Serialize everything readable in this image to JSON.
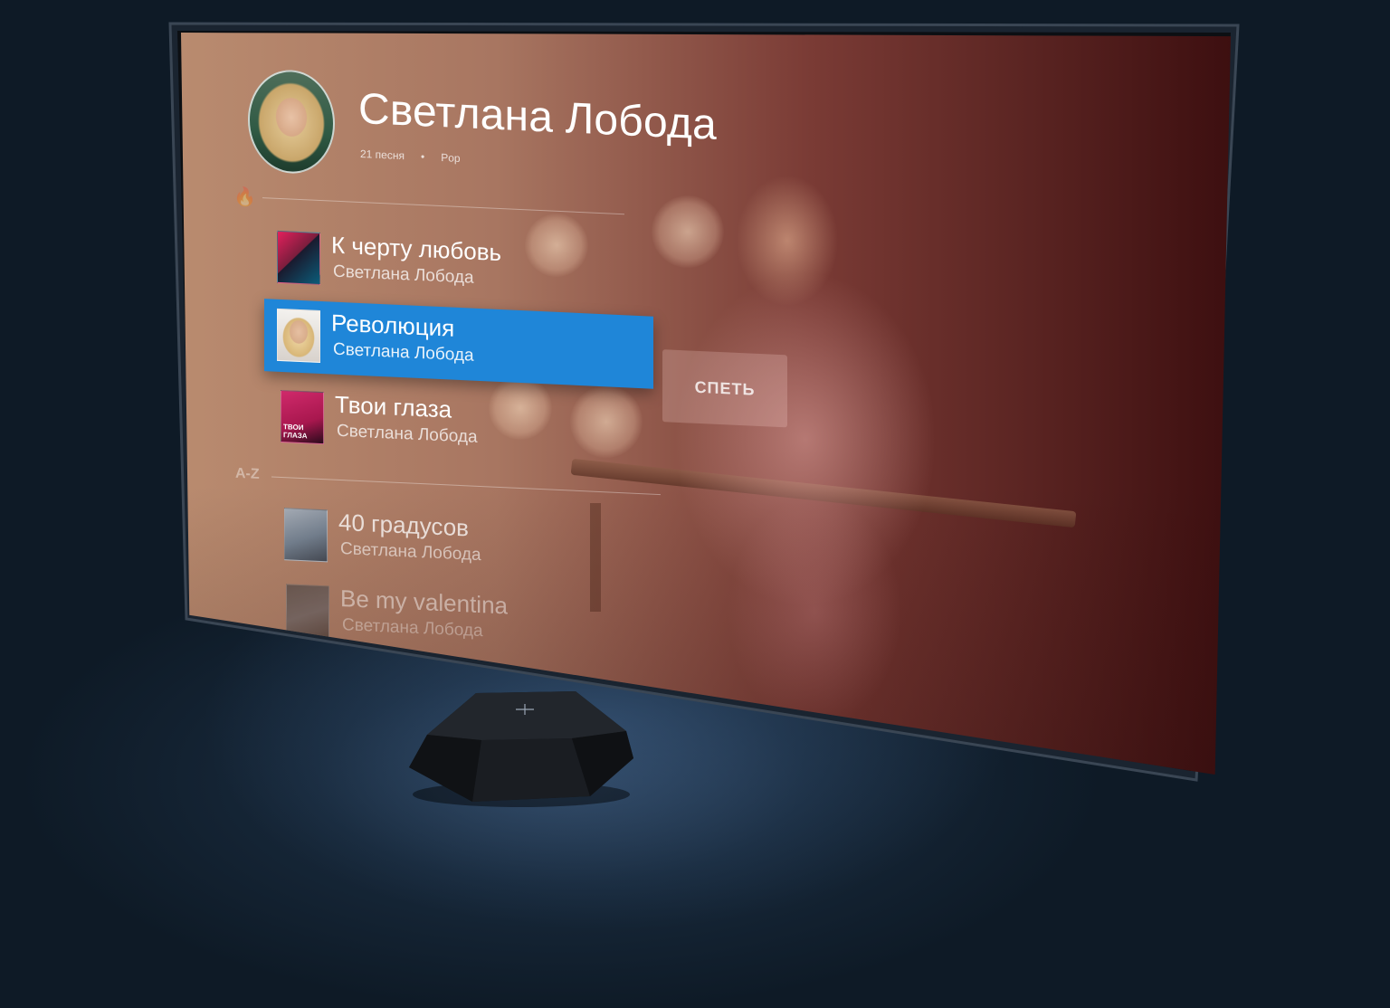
{
  "artist": {
    "name": "Светлана Лобода",
    "song_count": "21 песня",
    "genre": "Pop"
  },
  "sections": {
    "popular_icon": "flame-icon",
    "az_label": "A-Z"
  },
  "songs": [
    {
      "title": "К черту любовь",
      "artist": "Светлана Лобода",
      "selected": false
    },
    {
      "title": "Революция",
      "artist": "Светлана Лобода",
      "selected": true
    },
    {
      "title": "Твои глаза",
      "artist": "Светлана Лобода",
      "selected": false,
      "cover_text": "ТВОИ ГЛАЗА"
    },
    {
      "title": "40 градусов",
      "artist": "Светлана Лобода",
      "selected": false
    },
    {
      "title": "Be my valentina",
      "artist": "Светлана Лобода",
      "selected": false
    }
  ],
  "actions": {
    "sing_label": "СПЕТЬ"
  },
  "colors": {
    "selection": "#1f86d8",
    "background_dark": "#0e1a26"
  }
}
